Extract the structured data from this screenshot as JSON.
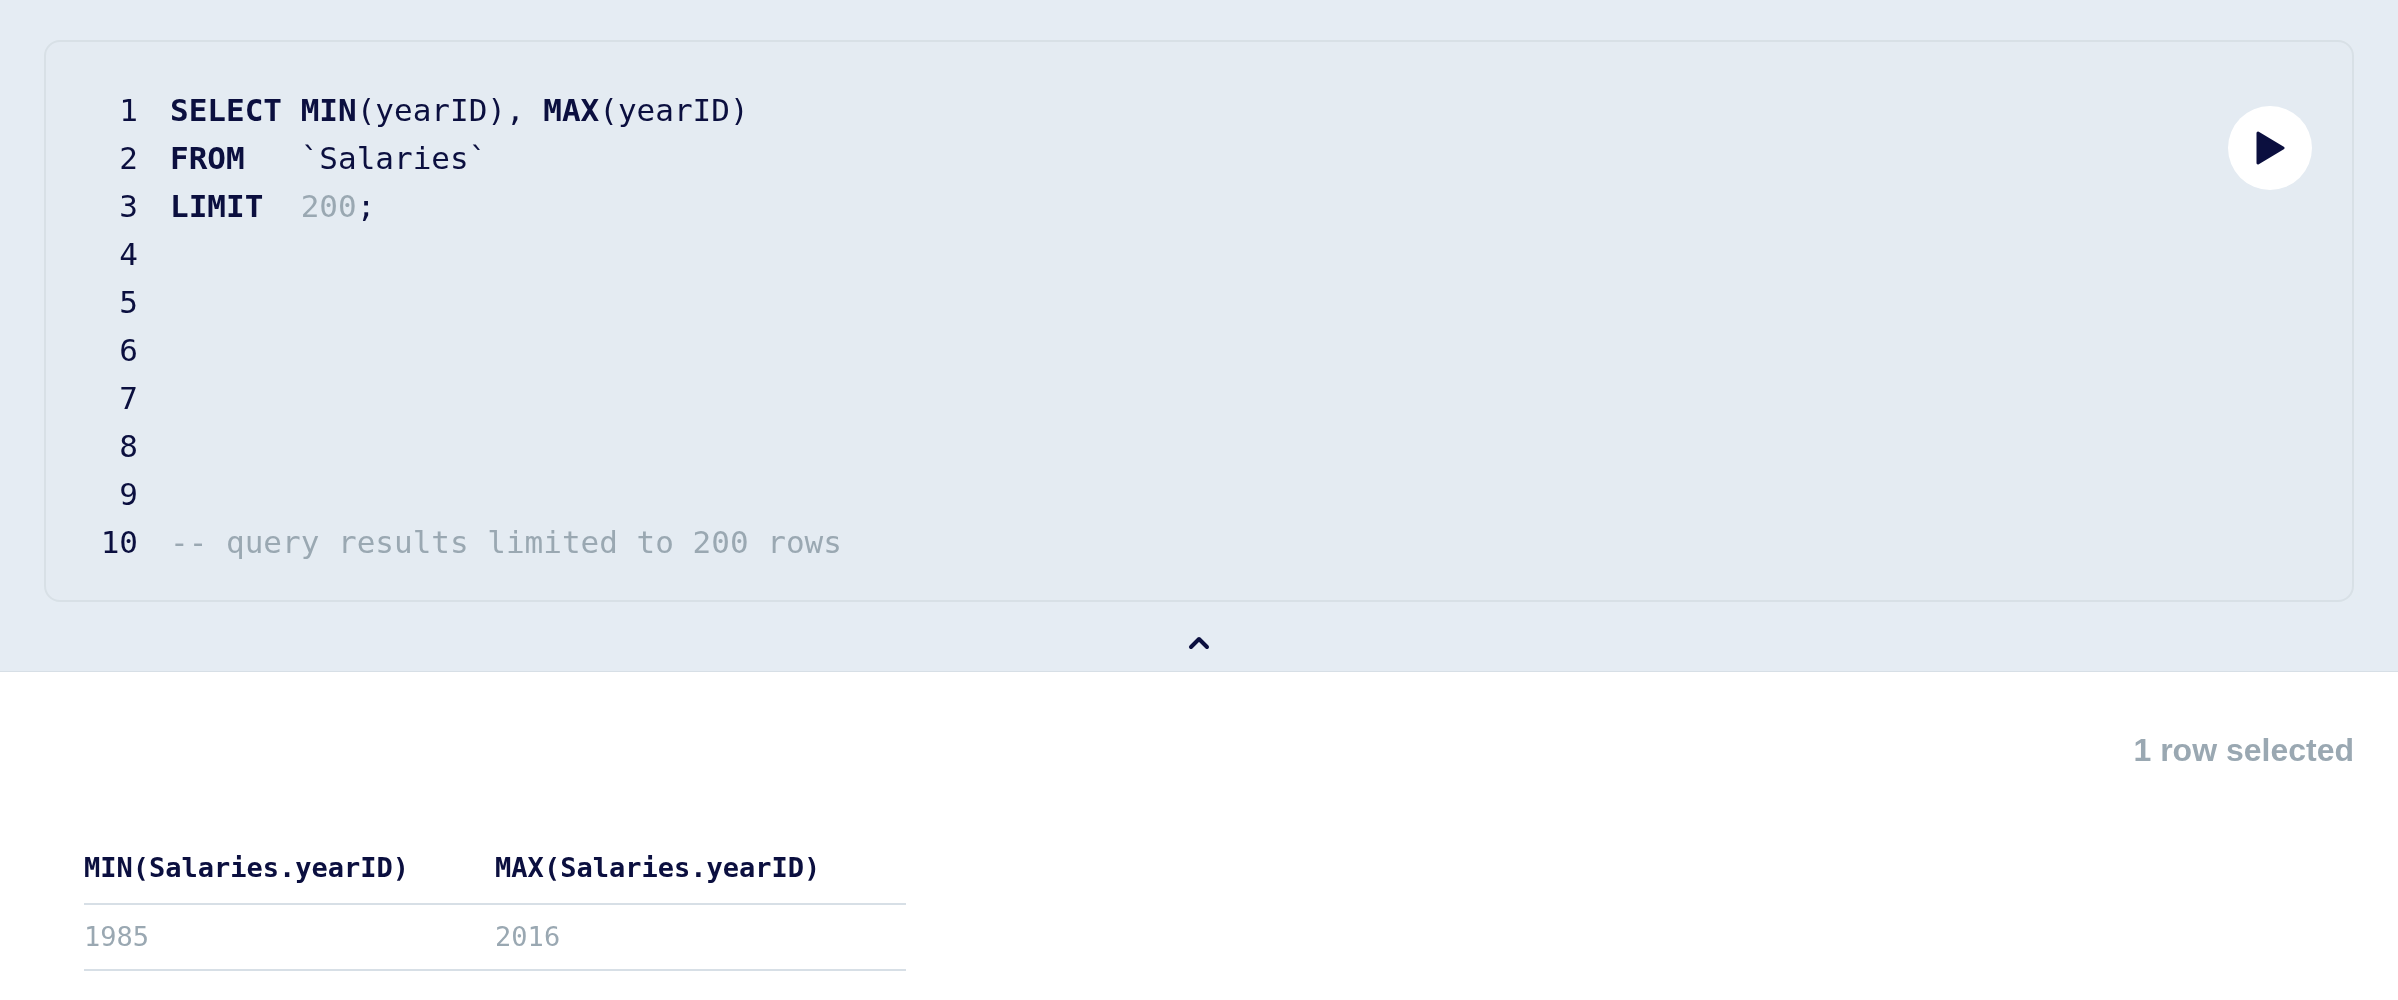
{
  "editor": {
    "lines": [
      {
        "number": "1",
        "tokens": [
          {
            "kind": "keyword",
            "text": "SELECT "
          },
          {
            "kind": "keyword",
            "text": "MIN"
          },
          {
            "kind": "plain",
            "text": "(yearID), "
          },
          {
            "kind": "keyword",
            "text": "MAX"
          },
          {
            "kind": "plain",
            "text": "(yearID)"
          }
        ]
      },
      {
        "number": "2",
        "tokens": [
          {
            "kind": "keyword",
            "text": "FROM"
          },
          {
            "kind": "plain",
            "text": "   `Salaries`"
          }
        ]
      },
      {
        "number": "3",
        "tokens": [
          {
            "kind": "keyword",
            "text": "LIMIT"
          },
          {
            "kind": "number",
            "text": "  200"
          },
          {
            "kind": "plain",
            "text": ";"
          }
        ]
      },
      {
        "number": "4"
      },
      {
        "number": "5"
      },
      {
        "number": "6"
      },
      {
        "number": "7"
      },
      {
        "number": "8"
      },
      {
        "number": "9"
      },
      {
        "number": "10",
        "tokens": [
          {
            "kind": "comment",
            "text": "-- query results limited to 200 rows"
          }
        ]
      }
    ]
  },
  "results": {
    "summary": "1 row selected",
    "columns": [
      "MIN(Salaries.yearID)",
      "MAX(Salaries.yearID)"
    ],
    "rows": [
      [
        "1985",
        "2016"
      ]
    ]
  }
}
